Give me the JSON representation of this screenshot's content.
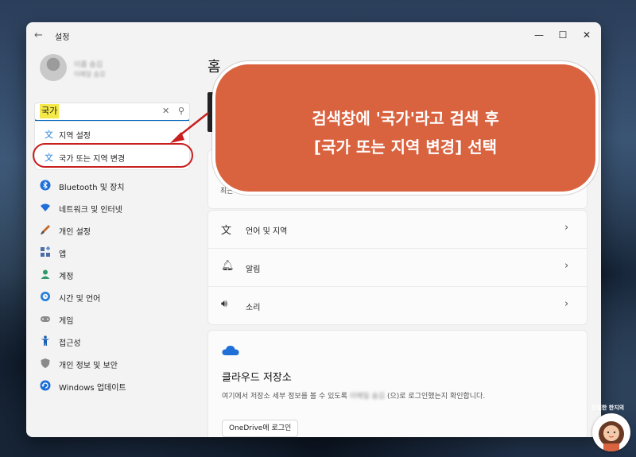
{
  "window": {
    "title": "설정",
    "back_glyph": "←",
    "minimize_glyph": "—",
    "maximize_glyph": "☐",
    "close_glyph": "✕"
  },
  "profile": {
    "name": "이름 숨김",
    "email": "이메일 숨김"
  },
  "search": {
    "value": "국가",
    "clear_glyph": "✕",
    "search_glyph": "⚲"
  },
  "dropdown": {
    "items": [
      {
        "label": "지역 설정",
        "icon": "region-settings-icon"
      },
      {
        "label": "국가 또는 지역 변경",
        "icon": "region-change-icon"
      }
    ]
  },
  "sidebar": {
    "items": [
      {
        "label": "Bluetooth 및 장치",
        "icon": "bluetooth-icon",
        "color": "#1f6fd8"
      },
      {
        "label": "네트워크 및 인터넷",
        "icon": "wifi-icon",
        "color": "#1f6fd8"
      },
      {
        "label": "개인 설정",
        "icon": "brush-icon",
        "color": "#c56a2a"
      },
      {
        "label": "앱",
        "icon": "apps-icon",
        "color": "#4a6fa5"
      },
      {
        "label": "계정",
        "icon": "account-icon",
        "color": "#2e9a6a"
      },
      {
        "label": "시간 및 언어",
        "icon": "clock-globe-icon",
        "color": "#2a7fd8"
      },
      {
        "label": "게임",
        "icon": "gamepad-icon",
        "color": "#777777"
      },
      {
        "label": "접근성",
        "icon": "accessibility-icon",
        "color": "#1a5fb4"
      },
      {
        "label": "개인 정보 및 보안",
        "icon": "shield-icon",
        "color": "#777777"
      },
      {
        "label": "Windows 업데이트",
        "icon": "update-icon",
        "color": "#1f6fd8"
      }
    ]
  },
  "main": {
    "home_title": "홈",
    "recent_text": "최근",
    "rows": [
      {
        "label": "언어 및 지역",
        "icon": "language-icon",
        "glyph": "⽂"
      },
      {
        "label": "알림",
        "icon": "bell-icon",
        "glyph": "🔔︎"
      },
      {
        "label": "소리",
        "icon": "speaker-icon",
        "glyph": "🔊︎"
      }
    ],
    "chevron": "›",
    "cloud": {
      "title": "클라우드 저장소",
      "desc_before": "여기에서 저장소 세부 정보를 볼 수 있도록",
      "desc_hidden": "이메일 숨김",
      "desc_after": "(으)로 로그인했는지 확인합니다.",
      "button": "OneDrive에 로그인"
    }
  },
  "callout": {
    "line1": "검색창에 '국가'라고 검색 후",
    "line2": "[국가 또는 지역 변경] 선택",
    "color": "#d9623f"
  },
  "mascot": {
    "label": "친절한 한지의"
  }
}
